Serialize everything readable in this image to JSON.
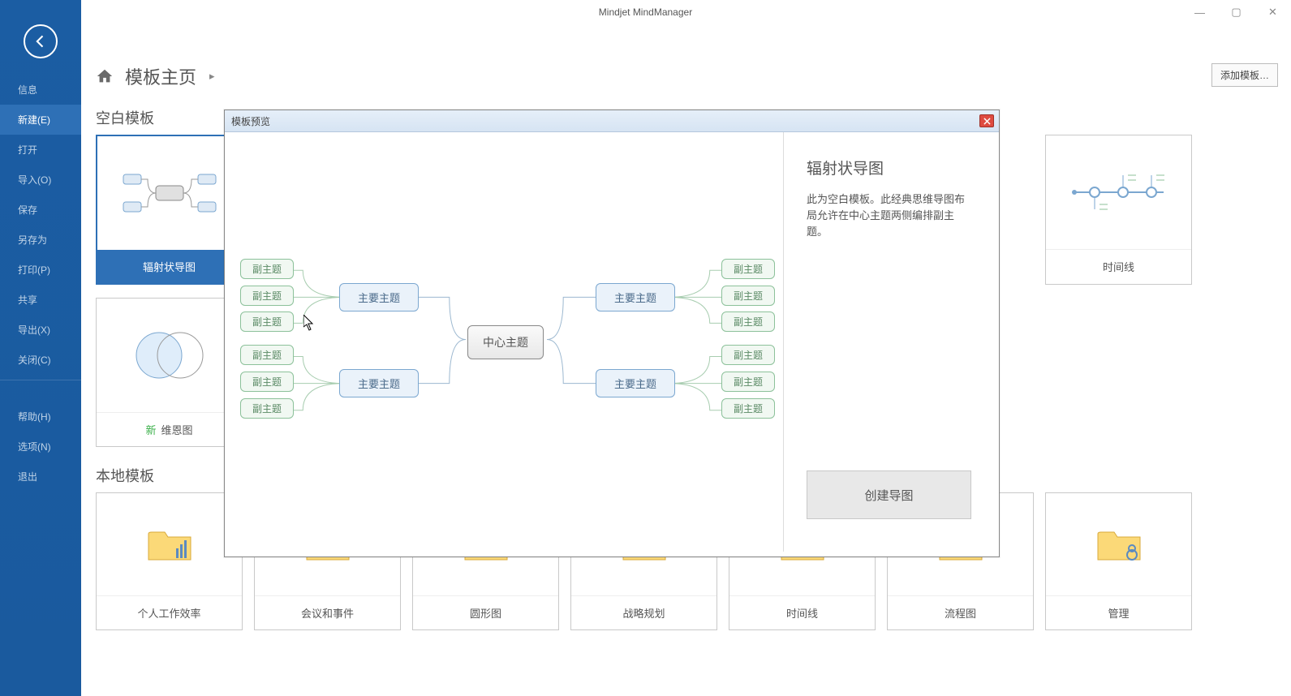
{
  "app": {
    "title": "Mindjet MindManager"
  },
  "sidebar": {
    "items": [
      "信息",
      "新建(E)",
      "打开",
      "导入(O)",
      "保存",
      "另存为",
      "打印(P)",
      "共享",
      "导出(X)",
      "关闭(C)"
    ],
    "items2": [
      "帮助(H)",
      "选项(N)",
      "退出"
    ]
  },
  "breadcrumb": {
    "label": "模板主页"
  },
  "add_template_btn": "添加模板…",
  "sections": {
    "blank": {
      "title": "空白模板"
    },
    "local": {
      "title": "本地模板"
    }
  },
  "blank_tiles": {
    "t1": {
      "label": "辐射状导图"
    },
    "t2": {
      "label": "维恩图",
      "new": "新"
    },
    "t7": {
      "label": "时间线"
    }
  },
  "local_tiles": [
    "个人工作效率",
    "会议和事件",
    "圆形图",
    "战略规划",
    "时间线",
    "流程图",
    "管理"
  ],
  "dialog": {
    "title": "模板预览",
    "heading": "辐射状导图",
    "description": "此为空白模板。此经典思维导图布局允许在中心主题两侧编排副主题。",
    "create_btn": "创建导图",
    "map": {
      "center": "中心主题",
      "main": "主要主题",
      "sub": "副主题"
    }
  }
}
